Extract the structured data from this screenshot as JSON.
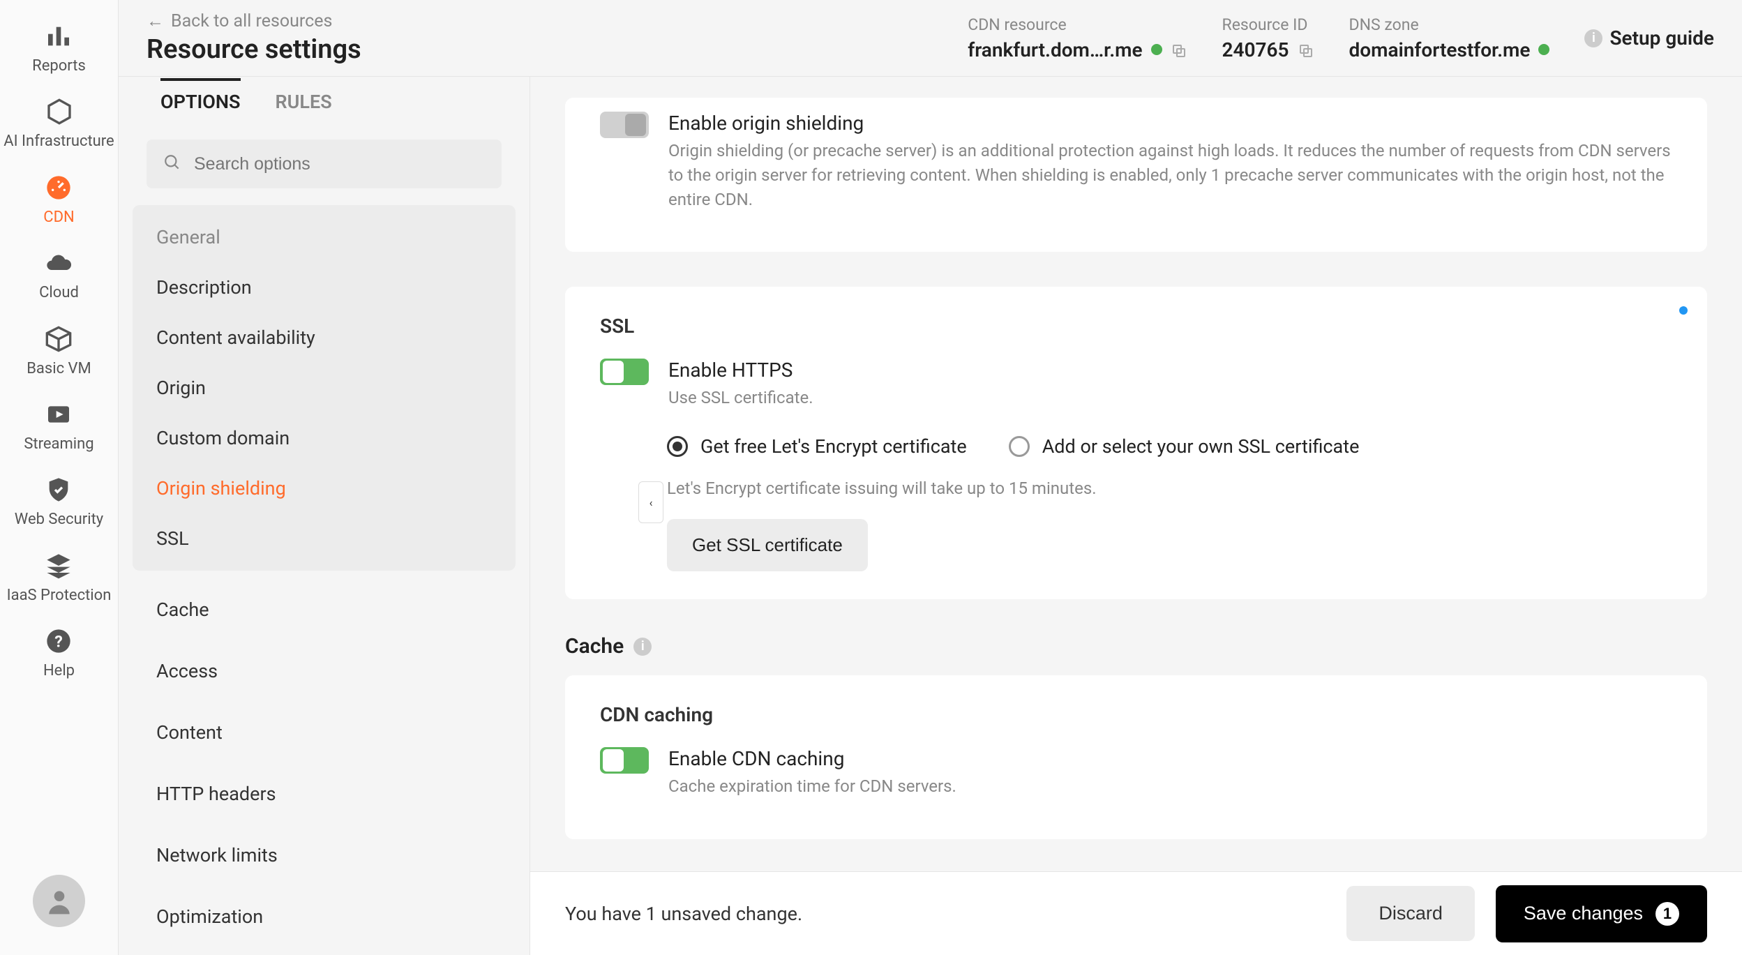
{
  "nav": {
    "items": [
      {
        "label": "Reports",
        "icon": "bar-chart-icon"
      },
      {
        "label": "AI Infrastructure",
        "icon": "hexagon-icon"
      },
      {
        "label": "CDN",
        "icon": "gauge-icon",
        "active": true
      },
      {
        "label": "Cloud",
        "icon": "cloud-icon"
      },
      {
        "label": "Basic VM",
        "icon": "cube-icon"
      },
      {
        "label": "Streaming",
        "icon": "play-icon"
      },
      {
        "label": "Web Security",
        "icon": "shield-icon"
      },
      {
        "label": "IaaS Protection",
        "icon": "layers-icon"
      },
      {
        "label": "Help",
        "icon": "help-icon"
      }
    ]
  },
  "header": {
    "back": "Back to all resources",
    "title": "Resource settings",
    "cdn_resource_label": "CDN resource",
    "cdn_resource_value": "frankfurt.dom…r.me",
    "resource_id_label": "Resource ID",
    "resource_id_value": "240765",
    "dns_zone_label": "DNS zone",
    "dns_zone_value": "domainfortestfor.me",
    "setup_guide": "Setup guide"
  },
  "tabs": {
    "options": "OPTIONS",
    "rules": "RULES"
  },
  "search": {
    "placeholder": "Search options"
  },
  "sidebar": {
    "general_group": {
      "title": "General",
      "items": [
        "Description",
        "Content availability",
        "Origin",
        "Custom domain",
        "Origin shielding",
        "SSL"
      ]
    },
    "sections": [
      "Cache",
      "Access",
      "Content",
      "HTTP headers",
      "Network limits",
      "Optimization"
    ]
  },
  "origin_shielding": {
    "toggle_label": "Enable origin shielding",
    "desc": "Origin shielding (or precache server) is an additional protection against high loads. It reduces the number of requests from CDN servers to the origin server for retrieving content. When shielding is enabled, only 1 precache server communicates with the origin host, not the entire CDN."
  },
  "ssl": {
    "heading": "SSL",
    "toggle_label": "Enable HTTPS",
    "toggle_desc": "Use SSL certificate.",
    "radio_lets_encrypt": "Get free Let's Encrypt certificate",
    "radio_own": "Add or select your own SSL certificate",
    "hint": "Let's Encrypt certificate issuing will take up to 15 minutes.",
    "button": "Get SSL certificate"
  },
  "cache_section": {
    "heading": "Cache",
    "cdn_caching_title": "CDN caching",
    "toggle_label": "Enable CDN caching",
    "toggle_desc": "Cache expiration time for CDN servers."
  },
  "footer": {
    "message": "You have 1 unsaved change.",
    "discard": "Discard",
    "save": "Save changes",
    "save_count": "1"
  }
}
